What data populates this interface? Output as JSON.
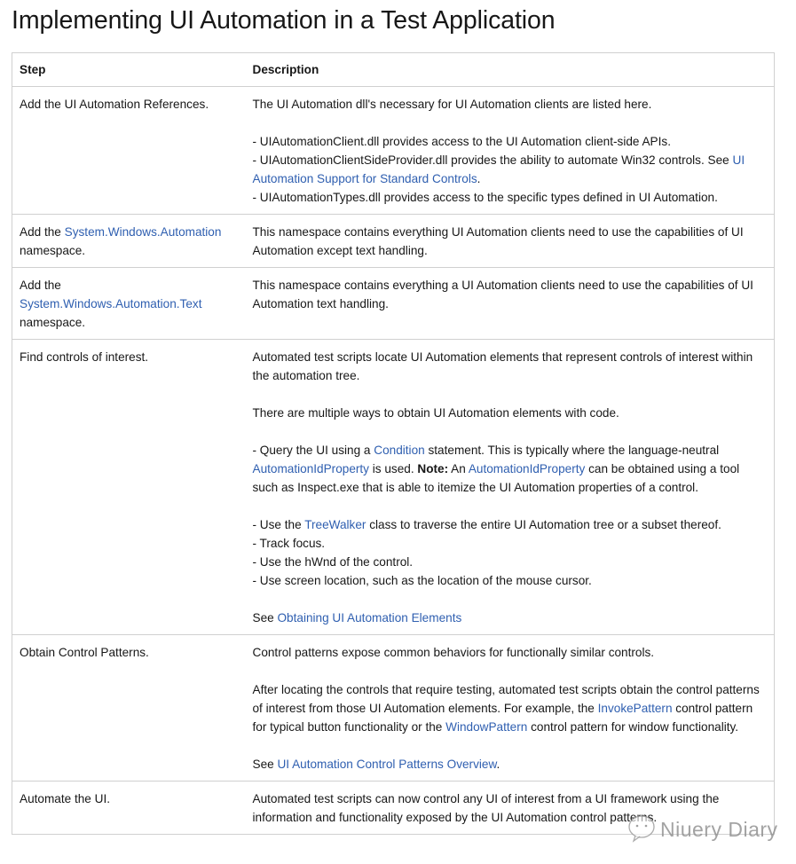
{
  "title": "Implementing UI Automation in a Test Application",
  "table": {
    "headers": {
      "step": "Step",
      "description": "Description"
    },
    "rows": [
      {
        "step": {
          "pre": "Add the UI Automation References."
        },
        "desc": {
          "p1": "The UI Automation dll's necessary for UI Automation clients are listed here.",
          "l1": "- UIAutomationClient.dll provides access to the UI Automation client-side APIs.",
          "l2_pre": "- UIAutomationClientSideProvider.dll provides the ability to automate Win32 controls. See ",
          "l2_link": "UI Automation Support for Standard Controls",
          "l2_post": ".",
          "l3": "- UIAutomationTypes.dll provides access to the specific types defined in UI Automation."
        }
      },
      {
        "step": {
          "pre": "Add the ",
          "link": "System.Windows.Automation",
          "post": " namespace."
        },
        "desc": {
          "p1": "This namespace contains everything UI Automation clients need to use the capabilities of UI Automation except text handling."
        }
      },
      {
        "step": {
          "pre": "Add the ",
          "link": "System.Windows.Automation.Text",
          "post": " namespace."
        },
        "desc": {
          "p1": "This namespace contains everything a UI Automation clients need to use the capabilities of UI Automation text handling."
        }
      },
      {
        "step": {
          "pre": "Find controls of interest."
        },
        "desc": {
          "p1": "Automated test scripts locate UI Automation elements that represent controls of interest within the automation tree.",
          "p2": "There are multiple ways to obtain UI Automation elements with code.",
          "q_pre": "- Query the UI using a ",
          "q_link1": "Condition",
          "q_mid1": " statement. This is typically where the language-neutral ",
          "q_link2": "AutomationIdProperty",
          "q_mid2": " is used. ",
          "q_note": "Note:",
          "q_mid3": " An ",
          "q_link3": "AutomationIdProperty",
          "q_post": " can be obtained using a tool such as Inspect.exe that is able to itemize the UI Automation properties of a control.",
          "b1_pre": "- Use the ",
          "b1_link": "TreeWalker",
          "b1_post": " class to traverse the entire UI Automation tree or a subset thereof.",
          "b2": "- Track focus.",
          "b3": "- Use the hWnd of the control.",
          "b4": "- Use screen location, such as the location of the mouse cursor.",
          "see_pre": "See ",
          "see_link": "Obtaining UI Automation Elements"
        }
      },
      {
        "step": {
          "pre": "Obtain Control Patterns."
        },
        "desc": {
          "p1": "Control patterns expose common behaviors for functionally similar controls.",
          "p2_pre": "After locating the controls that require testing, automated test scripts obtain the control patterns of interest from those UI Automation elements. For example, the ",
          "p2_link1": "InvokePattern",
          "p2_mid": " control pattern for typical button functionality or the ",
          "p2_link2": "WindowPattern",
          "p2_post": " control pattern for window functionality.",
          "see_pre": "See ",
          "see_link": "UI Automation Control Patterns Overview",
          "see_post": "."
        }
      },
      {
        "step": {
          "pre": "Automate the UI."
        },
        "desc": {
          "p1": "Automated test scripts can now control any UI of interest from a UI framework using the information and functionality exposed by the UI Automation control patterns."
        }
      }
    ]
  },
  "watermark": {
    "text": "Niuery Diary",
    "icon": "chat-bubble-icon"
  },
  "colors": {
    "link": "#2f5fb0",
    "text": "#171717",
    "border": "#d0d0d0"
  }
}
